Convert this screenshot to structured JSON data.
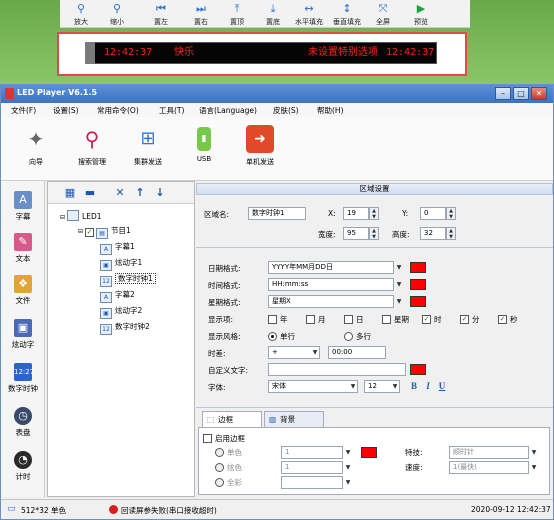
{
  "preview_toolbar": {
    "buttons": [
      {
        "label": "放大",
        "icon": "zoom-in-icon"
      },
      {
        "label": "缩小",
        "icon": "zoom-out-icon"
      },
      {
        "label": "置左",
        "icon": "align-left-icon"
      },
      {
        "label": "置右",
        "icon": "align-right-icon"
      },
      {
        "label": "置顶",
        "icon": "align-top-icon"
      },
      {
        "label": "置底",
        "icon": "align-bottom-icon"
      },
      {
        "label": "水平填充",
        "icon": "fill-horizontal-icon"
      },
      {
        "label": "垂直填充",
        "icon": "fill-vertical-icon"
      },
      {
        "label": "全屏",
        "icon": "fullscreen-icon"
      },
      {
        "label": "预览",
        "icon": "play-icon"
      }
    ]
  },
  "led_preview": {
    "segments": [
      "12:42:37",
      "快乐",
      "未设置特别选项",
      "12:42:37"
    ],
    "text_color": "#ff2020",
    "background": "#050505"
  },
  "window": {
    "title": "LED Player V6.1.5",
    "menu": [
      "文件(F)",
      "设置(S)",
      "常用命令(O)",
      "工具(T)",
      "语言(Language)",
      "皮肤(S)",
      "帮助(H)"
    ]
  },
  "main_toolbar": [
    {
      "label": "向导",
      "icon": "wizard-icon"
    },
    {
      "label": "搜索管理",
      "icon": "search-icon"
    },
    {
      "label": "集群发送",
      "icon": "network-icon"
    },
    {
      "label": "USB",
      "icon": "usb-icon"
    },
    {
      "label": "单机发送",
      "icon": "send-icon"
    }
  ],
  "left_tools": [
    {
      "label": "字幕",
      "icon": "subtitle-icon"
    },
    {
      "label": "文本",
      "icon": "text-icon"
    },
    {
      "label": "文件",
      "icon": "file-icon"
    },
    {
      "label": "炫动字",
      "icon": "animated-text-icon"
    },
    {
      "label": "数字时钟",
      "icon": "digital-clock-icon"
    },
    {
      "label": "表盘",
      "icon": "dial-clock-icon"
    },
    {
      "label": "计时",
      "icon": "timer-icon"
    }
  ],
  "tree": {
    "root": "LED1",
    "program": "节目1",
    "items": [
      "字幕1",
      "炫动字1",
      "数字时钟1",
      "字幕2",
      "炫动字2",
      "数字时钟2"
    ],
    "selected_index": 2
  },
  "area_settings": {
    "header": "区域设置",
    "name_label": "区域名:",
    "name_value": "数字时钟1",
    "x_label": "X:",
    "x_value": "19",
    "y_label": "Y:",
    "y_value": "0",
    "width_label": "宽度:",
    "width_value": "95",
    "height_label": "高度:",
    "height_value": "32"
  },
  "clock_settings": {
    "date_format_label": "日期格式:",
    "date_format_value": "YYYY年MM月DD日",
    "time_format_label": "时间格式:",
    "time_format_value": "HH:mm:ss",
    "week_format_label": "星期格式:",
    "week_format_value": "星期X",
    "display_label": "显示项:",
    "display_items": [
      {
        "label": "年",
        "checked": false
      },
      {
        "label": "月",
        "checked": false
      },
      {
        "label": "日",
        "checked": false
      },
      {
        "label": "星期",
        "checked": false
      },
      {
        "label": "时",
        "checked": true
      },
      {
        "label": "分",
        "checked": true
      },
      {
        "label": "秒",
        "checked": true
      }
    ],
    "style_label": "显示风格:",
    "style_single": "单行",
    "style_multi": "多行",
    "timediff_label": "时差:",
    "timediff_sign": "+",
    "timediff_value": "00:00",
    "custom_text_label": "自定义文字:",
    "custom_text_value": "",
    "font_label": "字体:",
    "font_value": "宋体",
    "font_size": "12",
    "bold": "B",
    "italic": "I",
    "underline": "U",
    "color": "#ff0000"
  },
  "tabs": [
    "边框",
    "背景"
  ],
  "border_settings": {
    "enable_label": "启用边框",
    "single_label": "单色",
    "dazzle_label": "炫色",
    "full_label": "全彩",
    "line_value": "1",
    "effect_label": "特技:",
    "effect_value": "顺时针",
    "speed_label": "速度:",
    "speed_value": "1(最快)"
  },
  "status": {
    "screen": "512*32 单色",
    "message": "回读屏参失败(串口接收超时)",
    "datetime": "2020-09-12 12:42:37"
  }
}
